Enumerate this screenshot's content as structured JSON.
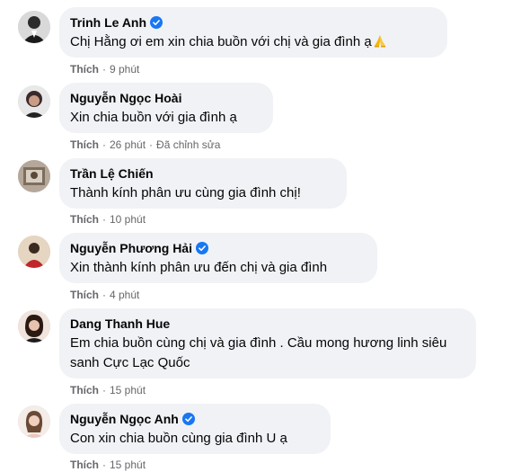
{
  "comments": [
    {
      "author": "Trinh Le Anh",
      "verified": true,
      "text": "Chị Hằng ơi em xin chia buồn với chị và gia đình ạ",
      "emoji": "folded-hands",
      "like_label": "Thích",
      "time": "9 phút",
      "edited": ""
    },
    {
      "author": "Nguyễn Ngọc Hoài",
      "verified": false,
      "text": "Xin chia buồn với gia đình ạ",
      "like_label": "Thích",
      "time": "26 phút",
      "edited": "Đã chỉnh sửa"
    },
    {
      "author": "Trần Lệ Chiến",
      "verified": false,
      "text": "Thành kính phân ưu cùng gia đình chị!",
      "like_label": "Thích",
      "time": "10 phút",
      "edited": ""
    },
    {
      "author": "Nguyễn Phương Hải",
      "verified": true,
      "text": "Xin thành kính phân ưu đến chị và gia đình",
      "like_label": "Thích",
      "time": "4 phút",
      "edited": ""
    },
    {
      "author": "Dang Thanh Hue",
      "verified": false,
      "text": "Em chia buồn cùng chị và gia đình . Cầu mong hương linh siêu sanh Cực Lạc Quốc",
      "like_label": "Thích",
      "time": "15 phút",
      "edited": ""
    },
    {
      "author": "Nguyễn Ngọc Anh",
      "verified": true,
      "text": "Con xin chia buồn cùng gia đình U ạ",
      "like_label": "Thích",
      "time": "15 phút",
      "edited": ""
    }
  ],
  "colors": {
    "bubble": "#f0f2f5",
    "verified": "#1877f2",
    "meta": "#65676b"
  }
}
